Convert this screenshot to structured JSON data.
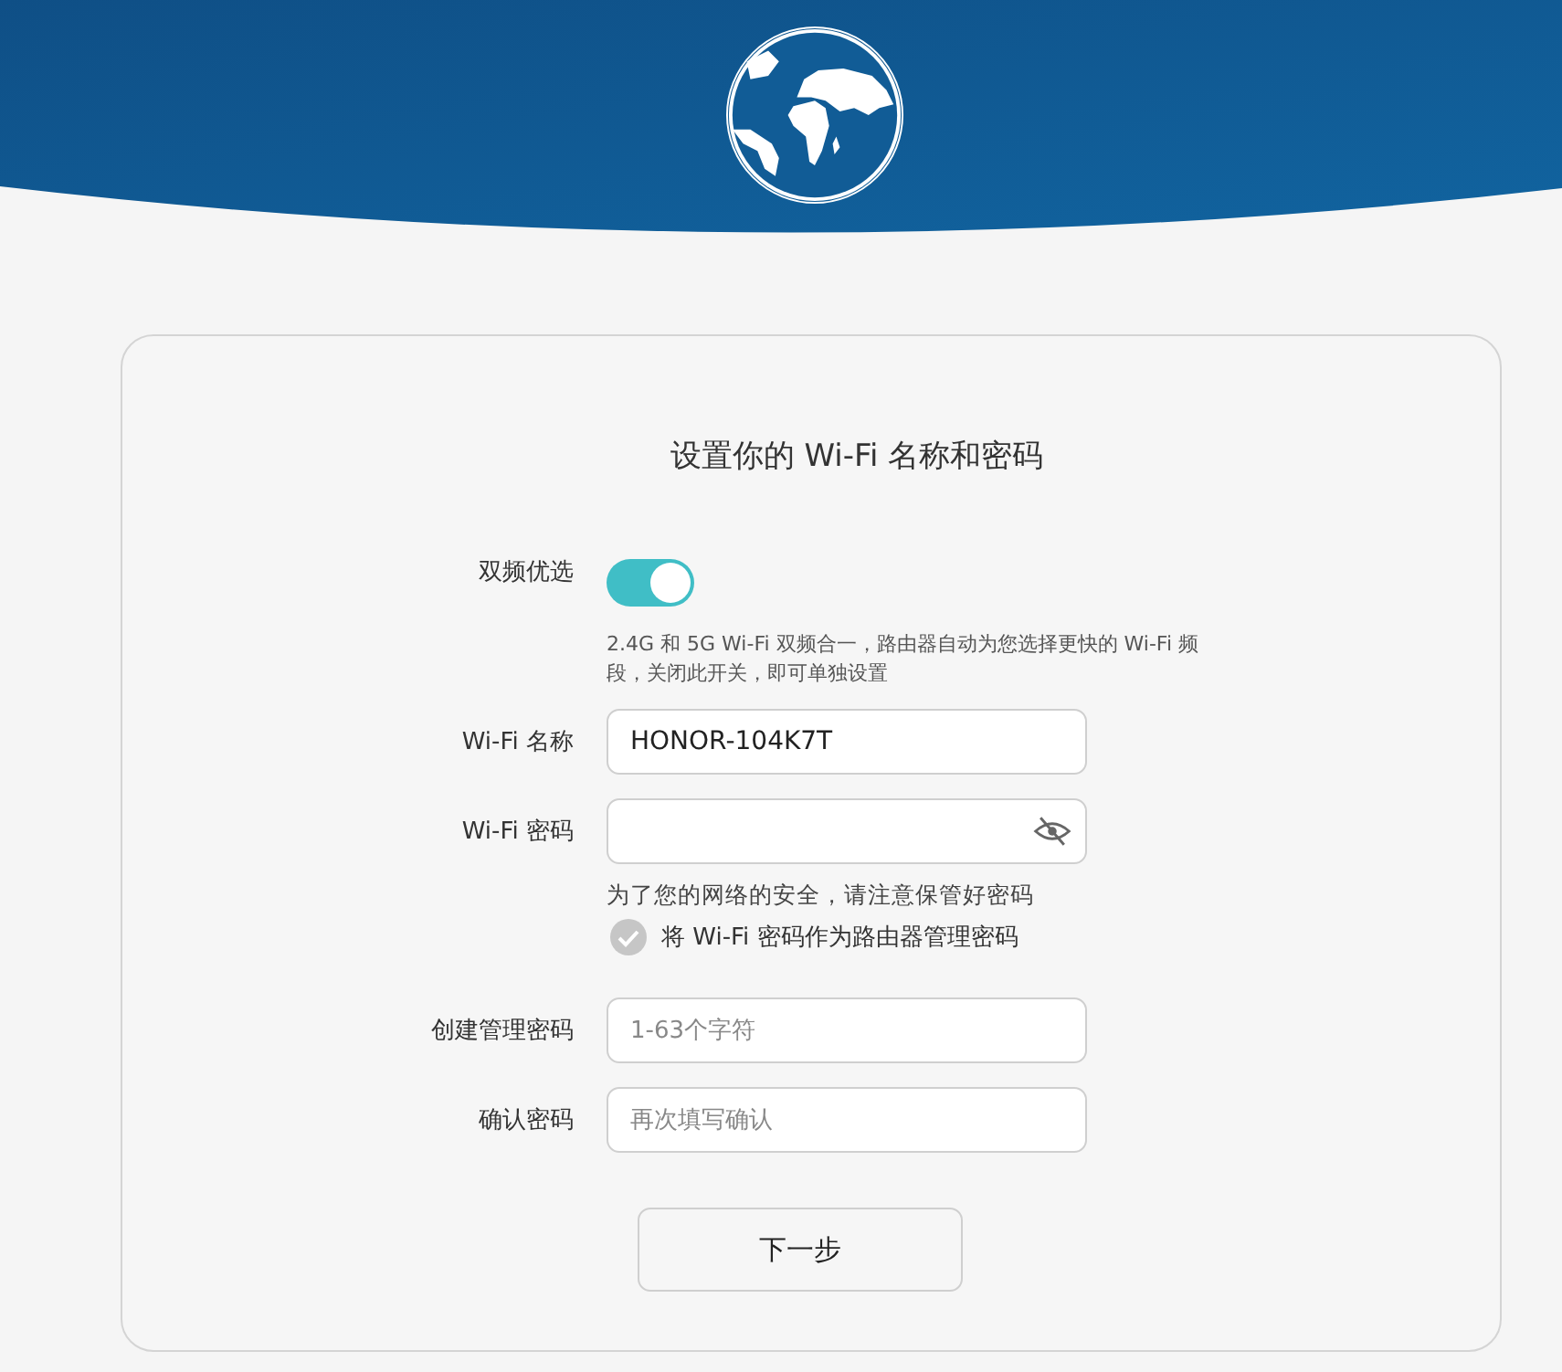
{
  "title": "设置你的 Wi-Fi 名称和密码",
  "dual_band": {
    "label": "双频优选",
    "on": true,
    "hint": "2.4G 和 5G Wi-Fi 双频合一，路由器自动为您选择更快的 Wi-Fi 频段，关闭此开关，即可单独设置"
  },
  "wifi_fields": [
    {
      "label": "Wi-Fi 名称",
      "kind": "text",
      "value": "HONOR-104K7T"
    },
    {
      "label": "Wi-Fi 密码",
      "kind": "password"
    }
  ],
  "password_note": "为了您的网络的安全，请注意保管好密码",
  "use_as_admin": {
    "label": "将 Wi-Fi 密码作为路由器管理密码",
    "checked": false
  },
  "admin_fields": [
    {
      "label": "创建管理密码",
      "placeholder": "1-63个字符"
    },
    {
      "label": "确认密码",
      "placeholder": "再次填写确认"
    }
  ],
  "next_button": "下一步"
}
